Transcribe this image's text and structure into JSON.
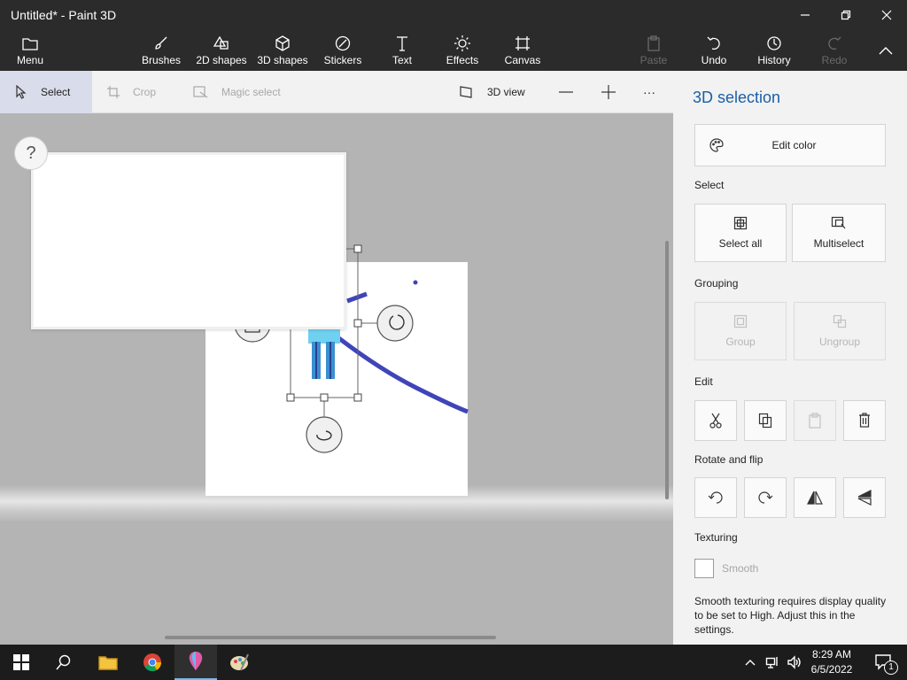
{
  "window": {
    "title": "Untitled* - Paint 3D"
  },
  "ribbon": {
    "menu": "Menu",
    "brushes": "Brushes",
    "shapes2d": "2D shapes",
    "shapes3d": "3D shapes",
    "stickers": "Stickers",
    "text": "Text",
    "effects": "Effects",
    "canvas": "Canvas",
    "paste": "Paste",
    "undo": "Undo",
    "history": "History",
    "redo": "Redo"
  },
  "toolbar": {
    "select": "Select",
    "crop": "Crop",
    "magic_select": "Magic select",
    "view3d": "3D view",
    "more": "···"
  },
  "workspace": {
    "help": "?"
  },
  "panel": {
    "title": "3D selection",
    "edit_color": "Edit color",
    "select_heading": "Select",
    "select_all": "Select all",
    "multiselect": "Multiselect",
    "grouping_heading": "Grouping",
    "group": "Group",
    "ungroup": "Ungroup",
    "edit_heading": "Edit",
    "rotate_heading": "Rotate and flip",
    "texturing_heading": "Texturing",
    "smooth": "Smooth",
    "note": "Smooth texturing requires display quality to be set to High. Adjust this in the settings."
  },
  "taskbar": {
    "time": "8:29 AM",
    "date": "6/5/2022",
    "notification_count": "1"
  },
  "colors": {
    "accent": "#1a5fa6",
    "stroke": "#3f45b8",
    "figure": "#3a8fd0"
  }
}
